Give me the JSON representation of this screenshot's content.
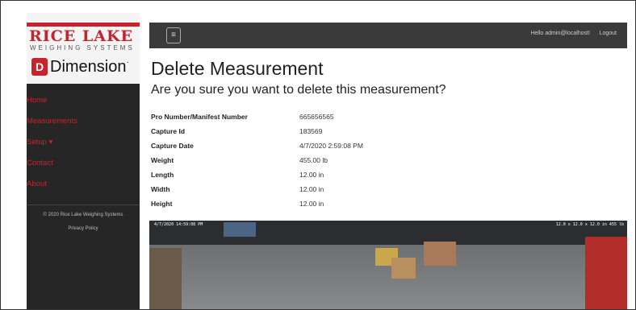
{
  "sidebar": {
    "brand": "RICE LAKE",
    "brand_sub": "WEIGHING SYSTEMS",
    "product_badge": "D",
    "product": "Dimension",
    "product_mark": "·",
    "nav": [
      {
        "label": "Home"
      },
      {
        "label": "Measurements"
      },
      {
        "label": "Setup ▾"
      },
      {
        "label": "Contact"
      },
      {
        "label": "About"
      }
    ],
    "copyright": "© 2020 Rice Lake Weighing Systems",
    "privacy": "Privacy Policy"
  },
  "topbar": {
    "menu_icon": "hamburger-icon",
    "hello": "Hello admin@localhost!",
    "logout": "Logout"
  },
  "page": {
    "title": "Delete Measurement",
    "subtitle": "Are you sure you want to delete this measurement?"
  },
  "details": [
    {
      "label": "Pro Number/Manifest Number",
      "value": "665656565"
    },
    {
      "label": "Capture Id",
      "value": "183569"
    },
    {
      "label": "Capture Date",
      "value": "4/7/2020 2:59:08 PM"
    },
    {
      "label": "Weight",
      "value": "455.00 lb"
    },
    {
      "label": "Length",
      "value": "12.00 in"
    },
    {
      "label": "Width",
      "value": "12.00 in"
    },
    {
      "label": "Height",
      "value": "12.00 in"
    }
  ],
  "camera": {
    "timestamp": "4/7/2020 14:59:08 PM",
    "overlay_right": "12.0 x 12.0 x 12.0 in  455 lb"
  },
  "colors": {
    "brand_red": "#c8232c",
    "sidebar_bg": "#262626",
    "topbar_bg": "#3a3a3a"
  }
}
